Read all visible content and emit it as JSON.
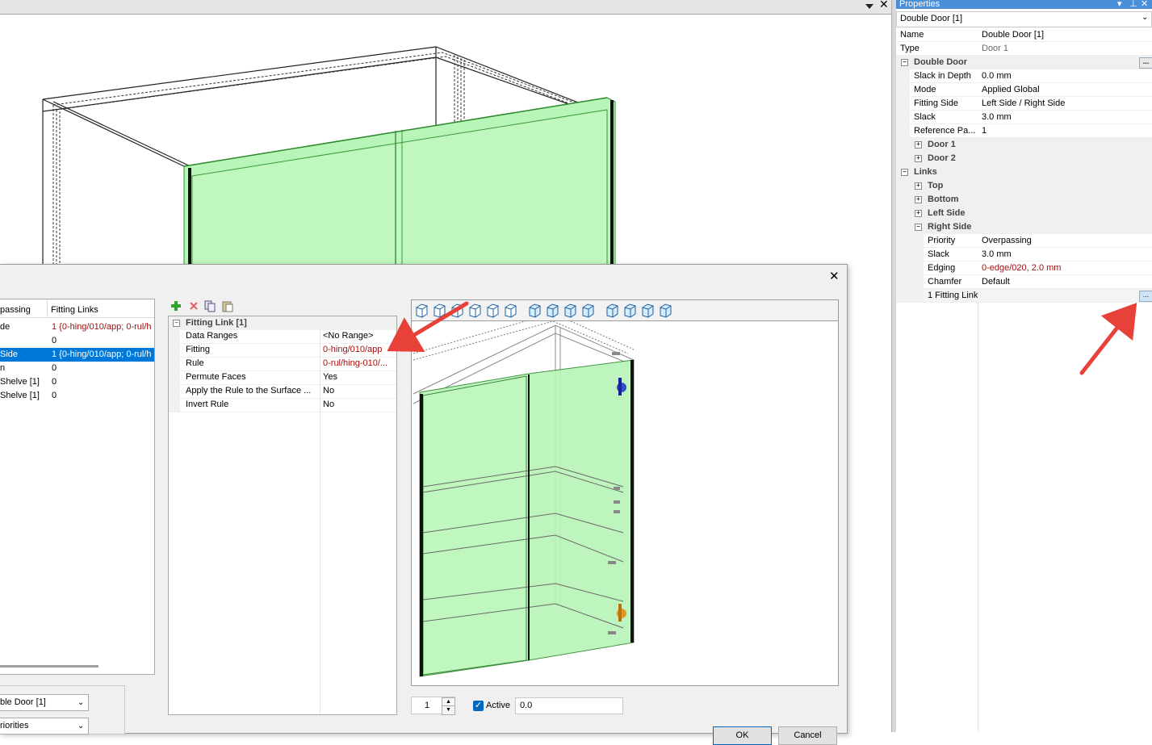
{
  "properties": {
    "title": "Properties",
    "selected_object": "Double Door [1]",
    "rows": [
      {
        "name": "Name",
        "value": "Double Door [1]",
        "indent": 0,
        "kind": "prop"
      },
      {
        "name": "Type",
        "value": "Door 1",
        "indent": 0,
        "kind": "prop",
        "muted": true
      },
      {
        "name": "Double Door",
        "value": "",
        "indent": 0,
        "kind": "section",
        "expanded": true,
        "has_button": true
      },
      {
        "name": "Slack in Depth",
        "value": "0.0 mm",
        "indent": 1,
        "kind": "prop"
      },
      {
        "name": "Mode",
        "value": "Applied Global",
        "indent": 1,
        "kind": "prop"
      },
      {
        "name": "Fitting Side",
        "value": "Left Side / Right Side",
        "indent": 1,
        "kind": "prop"
      },
      {
        "name": "Slack",
        "value": "3.0 mm",
        "indent": 1,
        "kind": "prop"
      },
      {
        "name": "Reference Pa...",
        "value": "1",
        "indent": 1,
        "kind": "prop"
      },
      {
        "name": "Door 1",
        "value": "",
        "indent": 1,
        "kind": "section",
        "expanded": false
      },
      {
        "name": "Door 2",
        "value": "",
        "indent": 1,
        "kind": "section",
        "expanded": false
      },
      {
        "name": "Links",
        "value": "",
        "indent": 0,
        "kind": "section",
        "expanded": true
      },
      {
        "name": "Top",
        "value": "",
        "indent": 1,
        "kind": "section",
        "expanded": false
      },
      {
        "name": "Bottom",
        "value": "",
        "indent": 1,
        "kind": "section",
        "expanded": false
      },
      {
        "name": "Left Side",
        "value": "",
        "indent": 1,
        "kind": "section",
        "expanded": false
      },
      {
        "name": "Right Side",
        "value": "",
        "indent": 1,
        "kind": "section",
        "expanded": true
      },
      {
        "name": "Priority",
        "value": "Overpassing",
        "indent": 2,
        "kind": "prop"
      },
      {
        "name": "Slack",
        "value": "3.0 mm",
        "indent": 2,
        "kind": "prop"
      },
      {
        "name": "Edging",
        "value": "0-edge/020, 2.0 mm",
        "indent": 2,
        "kind": "prop",
        "red": true
      },
      {
        "name": "Chamfer",
        "value": "Default",
        "indent": 2,
        "kind": "prop"
      },
      {
        "name": "1 Fitting Link",
        "value": "",
        "indent": 2,
        "kind": "prop",
        "has_button": true,
        "highlight": true
      }
    ],
    "ellipsis": "..."
  },
  "dialog": {
    "close_glyph": "✕",
    "left_table": {
      "headers": [
        "passing",
        "Fitting Links"
      ],
      "rows": [
        {
          "c1": "de",
          "c2": "1 {0-hing/010/app; 0-rul/h",
          "red": true,
          "selected": false
        },
        {
          "c1": "",
          "c2": "0",
          "red": false,
          "selected": false
        },
        {
          "c1": "Side",
          "c2": "1 {0-hing/010/app; 0-rul/h",
          "red": false,
          "selected": true
        },
        {
          "c1": "n",
          "c2": "0",
          "red": false,
          "selected": false
        },
        {
          "c1": " Shelve [1]",
          "c2": "0",
          "red": false,
          "selected": false
        },
        {
          "c1": "Shelve [1]",
          "c2": "0",
          "red": false,
          "selected": false
        }
      ]
    },
    "combo1": "ble Door [1]",
    "combo2": "riorities",
    "fitting_link": {
      "header": "Fitting Link [1]",
      "rows": [
        {
          "name": "Data Ranges",
          "value": "<No Range>",
          "red": false
        },
        {
          "name": "Fitting",
          "value": "0-hing/010/app",
          "red": true
        },
        {
          "name": "Rule",
          "value": "0-rul/hing-010/...",
          "red": true
        },
        {
          "name": "Permute Faces",
          "value": "Yes",
          "red": false
        },
        {
          "name": "Apply the Rule to the Surface ...",
          "value": "No",
          "red": false
        },
        {
          "name": "Invert Rule",
          "value": "No",
          "red": false
        }
      ]
    },
    "spinner_value": "1",
    "active_label": "Active",
    "active_checked": true,
    "offset_value": "0.0",
    "ok_label": "OK",
    "cancel_label": "Cancel"
  },
  "colors": {
    "accent": "#4a8fd8",
    "selection": "#0078d7",
    "door_green": "#b8f5b8",
    "error_red": "#a01010",
    "arrow_red": "#e8413a"
  }
}
